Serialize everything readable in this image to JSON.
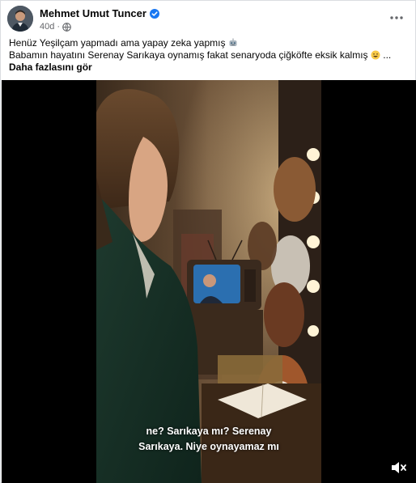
{
  "post": {
    "author": "Mehmet Umut Tuncer",
    "time": "40d",
    "line1": "Henüz Yeşilçam yapmadı ama yapay zeka yapmış",
    "line2": "Babamın hayatını Serenay Sarıkaya oynamış fakat senaryoda çiğköfte eksik kalmış",
    "ellipsis": "...",
    "see_more": "Daha fazlasını gör"
  },
  "video": {
    "subtitle_line1": "ne? Sarıkaya mı? Serenay",
    "subtitle_line2": "Sarıkaya. Niye oynayamaz mı"
  },
  "colors": {
    "verified": "#1877f2",
    "meta": "#65676b",
    "border": "#dadde1"
  },
  "icons": [
    "verified-badge-icon",
    "globe-icon",
    "more-options-icon",
    "robot-emoji-icon",
    "grinning-emoji-icon",
    "volume-muted-icon"
  ]
}
